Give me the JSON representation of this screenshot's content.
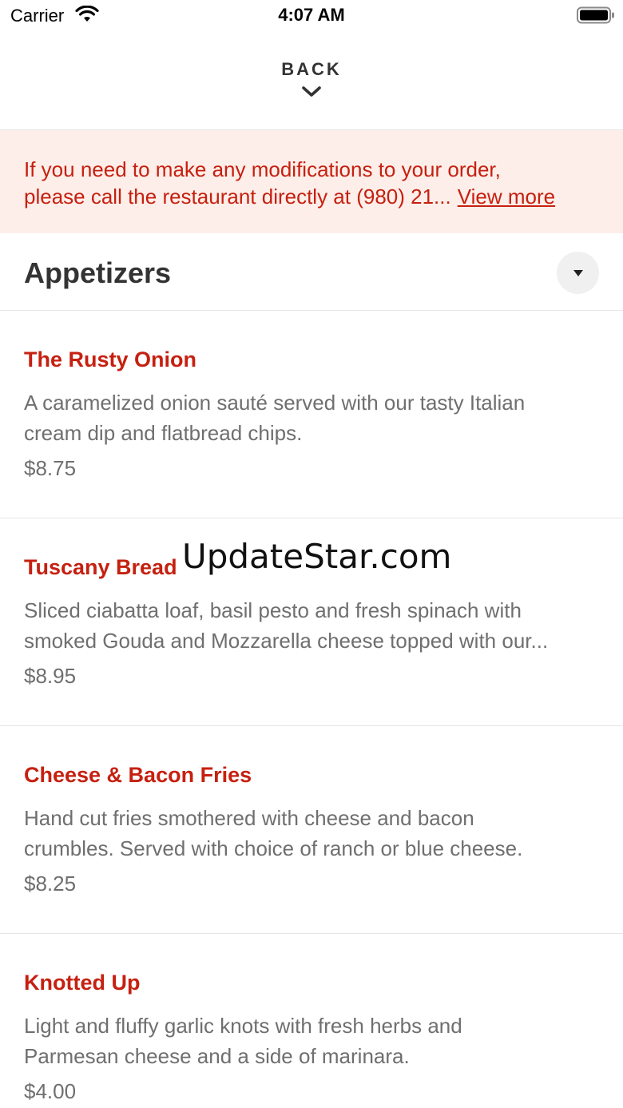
{
  "status_bar": {
    "carrier": "Carrier",
    "time": "4:07 AM"
  },
  "header": {
    "back_label": "BACK"
  },
  "notice": {
    "line1": "If you need to make any modifications to your order,",
    "line2": "please call the restaurant directly at (980) 21...",
    "link_label": "View more",
    "text_color": "#c62010",
    "background": "#fdeee9"
  },
  "section": {
    "title": "Appetizers"
  },
  "items": [
    {
      "name": "The Rusty Onion",
      "desc_line1": "A caramelized onion sauté served with our tasty Italian",
      "desc_line2": "cream dip and flatbread chips.",
      "price": "$8.75"
    },
    {
      "name": "Tuscany Bread",
      "desc_line1": "Sliced ciabatta loaf, basil pesto and fresh spinach with",
      "desc_line2": "smoked Gouda and Mozzarella cheese topped with our...",
      "price": "$8.95"
    },
    {
      "name": "Cheese & Bacon Fries",
      "desc_line1": "Hand cut fries smothered with cheese and bacon",
      "desc_line2": "crumbles. Served with choice of ranch or blue cheese.",
      "price": "$8.25"
    },
    {
      "name": "Knotted Up",
      "desc_line1": "Light and fluffy garlic knots with fresh herbs and",
      "desc_line2": "Parmesan cheese and a side of marinara.",
      "price": "$4.00"
    }
  ],
  "watermark": "UpdateStar.com",
  "icons": {
    "wifi": "wifi-icon",
    "battery": "battery-icon",
    "back": "chevron-down-icon",
    "toggle": "caret-down-icon"
  }
}
